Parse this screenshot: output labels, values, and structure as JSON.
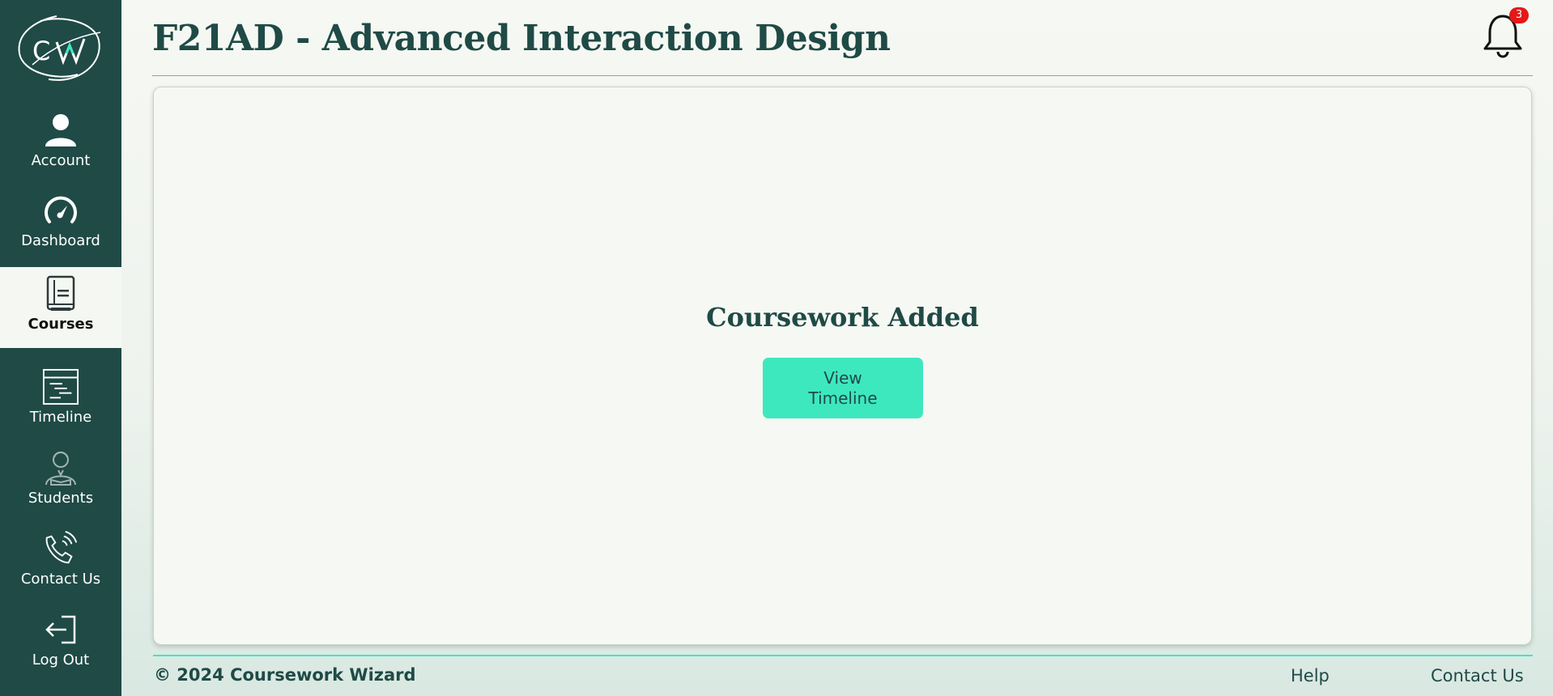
{
  "app": {
    "logo_text": "CW"
  },
  "sidebar": {
    "items": [
      {
        "label": "Account",
        "icon": "user-icon"
      },
      {
        "label": "Dashboard",
        "icon": "gauge-icon"
      },
      {
        "label": "Courses",
        "icon": "book-icon",
        "active": true
      },
      {
        "label": "Timeline",
        "icon": "timeline-icon"
      },
      {
        "label": "Students",
        "icon": "student-icon"
      },
      {
        "label": "Contact Us",
        "icon": "phone-icon"
      },
      {
        "label": "Log Out",
        "icon": "logout-icon"
      }
    ]
  },
  "header": {
    "title": "F21AD - Advanced Interaction Design",
    "notifications_count": "3"
  },
  "main": {
    "message": "Coursework Added",
    "button_label": "View Timeline"
  },
  "footer": {
    "copyright": "© 2024 Coursework Wizard",
    "help": "Help",
    "contact": "Contact Us"
  },
  "colors": {
    "sidebar": "#1f4a46",
    "accent": "#3de8bf",
    "badge": "#e51717",
    "background": "#f6f8f3"
  }
}
